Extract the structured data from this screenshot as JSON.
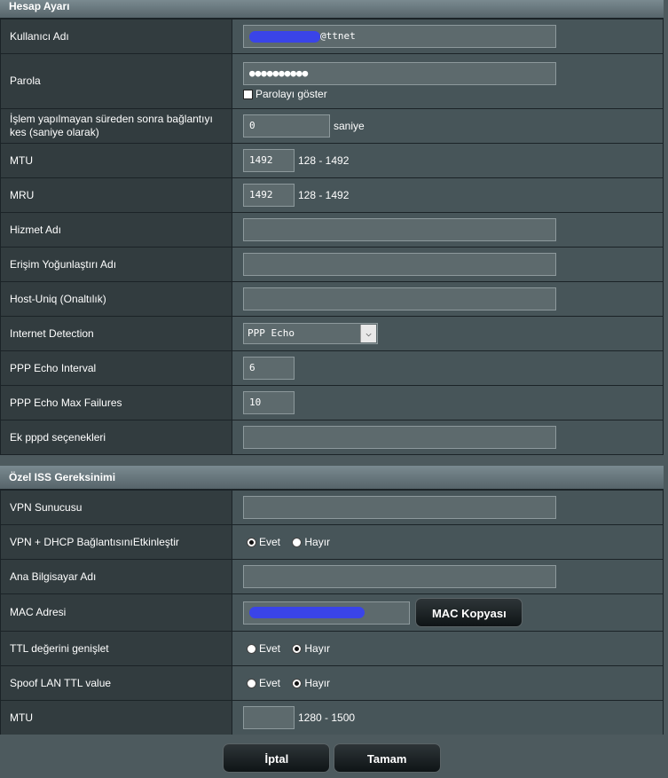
{
  "section1": {
    "title": "Hesap Ayarı",
    "rows": [
      {
        "label": "Kullanıcı Adı",
        "value_suffix": "@ttnet"
      },
      {
        "label": "Parola",
        "value": "●●●●●●●●●●",
        "show_password": "Parolayı göster"
      },
      {
        "label": "İşlem yapılmayan süreden sonra bağlantıyı kes (saniye olarak)",
        "value": "0",
        "unit": "saniye"
      },
      {
        "label": "MTU",
        "value": "1492",
        "range": "128 - 1492"
      },
      {
        "label": "MRU",
        "value": "1492",
        "range": "128 - 1492"
      },
      {
        "label": "Hizmet Adı",
        "value": ""
      },
      {
        "label": "Erişim Yoğunlaştırı Adı",
        "value": ""
      },
      {
        "label": "Host-Uniq (Onaltılık)",
        "value": ""
      },
      {
        "label": "Internet Detection",
        "value": "PPP Echo"
      },
      {
        "label": "PPP Echo Interval",
        "value": "6"
      },
      {
        "label": "PPP Echo Max Failures",
        "value": "10"
      },
      {
        "label": "Ek pppd seçenekleri",
        "value": ""
      }
    ]
  },
  "section2": {
    "title": "Özel ISS Gereksinimi",
    "rows": [
      {
        "label": "VPN Sunucusu",
        "value": ""
      },
      {
        "label": "VPN + DHCP BağlantısınıEtkinleştir",
        "yes": "Evet",
        "no": "Hayır",
        "selected": "Evet"
      },
      {
        "label": "Ana Bilgisayar Adı",
        "value": ""
      },
      {
        "label": "MAC Adresi",
        "button": "MAC Kopyası"
      },
      {
        "label": "TTL değerini genişlet",
        "yes": "Evet",
        "no": "Hayır",
        "selected": "Hayır"
      },
      {
        "label": "Spoof LAN TTL value",
        "yes": "Evet",
        "no": "Hayır",
        "selected": "Hayır"
      },
      {
        "label": "MTU",
        "value": "",
        "range": "1280 - 1500"
      }
    ]
  },
  "footer": {
    "cancel": "İptal",
    "ok": "Tamam"
  },
  "colors": {
    "redaction": "#3a44e8",
    "label_bg": "#323c3f",
    "value_bg": "#475559"
  },
  "icons": {
    "select_arrow": "chevron-down-icon"
  }
}
